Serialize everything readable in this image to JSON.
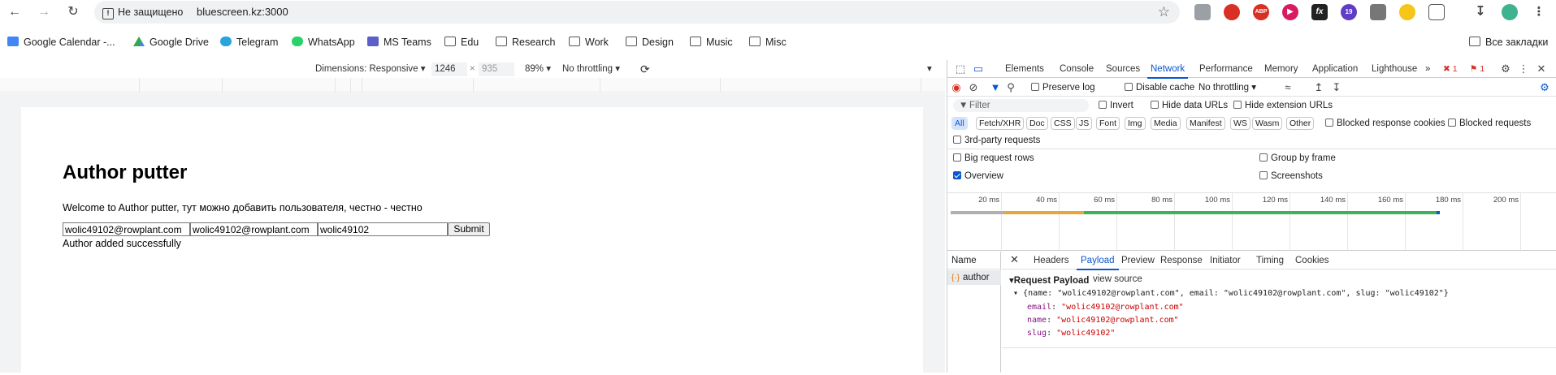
{
  "browser": {
    "security_label": "Не защищено",
    "url": "bluescreen.kz:3000",
    "all_bookmarks": "Все закладки",
    "extension_badge": "19"
  },
  "bookmarks": [
    {
      "label": "Google Calendar -...",
      "icon": "google-calendar-icon"
    },
    {
      "label": "Google Drive",
      "icon": "google-drive-icon"
    },
    {
      "label": "Telegram",
      "icon": "telegram-icon"
    },
    {
      "label": "WhatsApp",
      "icon": "whatsapp-icon"
    },
    {
      "label": "MS Teams",
      "icon": "ms-teams-icon"
    },
    {
      "label": "Edu",
      "icon": "folder-icon"
    },
    {
      "label": "Research",
      "icon": "folder-icon"
    },
    {
      "label": "Work",
      "icon": "folder-icon"
    },
    {
      "label": "Design",
      "icon": "folder-icon"
    },
    {
      "label": "Music",
      "icon": "folder-icon"
    },
    {
      "label": "Misc",
      "icon": "folder-icon"
    }
  ],
  "device_toolbar": {
    "dimensions": "Dimensions: Responsive",
    "width": "1246",
    "times": "×",
    "height": "935",
    "zoom": "89%",
    "throttling": "No throttling"
  },
  "page": {
    "title": "Author putter",
    "welcome": "Welcome to Author putter, тут можно добавить пользователя, честно - честно",
    "name_value": "wolic49102@rowplant.com",
    "email_value": "wolic49102@rowplant.com",
    "slug_value": "wolic49102",
    "submit_label": "Submit",
    "status": "Author added successfully"
  },
  "devtools": {
    "tabs": [
      "Elements",
      "Console",
      "Sources",
      "Network",
      "Performance",
      "Memory",
      "Application",
      "Lighthouse"
    ],
    "active_tab": "Network",
    "more": "»",
    "errors": "1",
    "warnings": "1",
    "toolbar": {
      "preserve_log": "Preserve log",
      "disable_cache": "Disable cache",
      "throttling": "No throttling"
    },
    "filter": {
      "placeholder": "Filter",
      "invert": "Invert",
      "hide_data_urls": "Hide data URLs",
      "hide_extension_urls": "Hide extension URLs"
    },
    "types": [
      "All",
      "Fetch/XHR",
      "Doc",
      "CSS",
      "JS",
      "Font",
      "Img",
      "Media",
      "Manifest",
      "WS",
      "Wasm",
      "Other"
    ],
    "blocked_cookies": "Blocked response cookies",
    "blocked_requests": "Blocked requests",
    "third_party": "3rd-party requests",
    "big_rows": "Big request rows",
    "group_by_frame": "Group by frame",
    "overview": "Overview",
    "screenshots": "Screenshots",
    "timeline_labels": [
      "20 ms",
      "40 ms",
      "60 ms",
      "80 ms",
      "100 ms",
      "120 ms",
      "140 ms",
      "160 ms",
      "180 ms",
      "200 ms"
    ],
    "requests": {
      "name_header": "Name",
      "items": [
        "author"
      ]
    },
    "detail_tabs": [
      "Headers",
      "Payload",
      "Preview",
      "Response",
      "Initiator",
      "Timing",
      "Cookies"
    ],
    "active_detail_tab": "Payload",
    "payload": {
      "heading": "Request Payload",
      "view_source": "view source",
      "summary": "{name: \"wolic49102@rowplant.com\", email: \"wolic49102@rowplant.com\", slug: \"wolic49102\"}",
      "fields": [
        {
          "key": "email",
          "value": "\"wolic49102@rowplant.com\""
        },
        {
          "key": "name",
          "value": "\"wolic49102@rowplant.com\""
        },
        {
          "key": "slug",
          "value": "\"wolic49102\""
        }
      ]
    }
  },
  "colors": {
    "accent": "#0b57d0",
    "waterfall_gray": "#b0b0b0",
    "waterfall_orange": "#e8a63a",
    "waterfall_green": "#3cb35a",
    "error_red": "#d93025"
  }
}
